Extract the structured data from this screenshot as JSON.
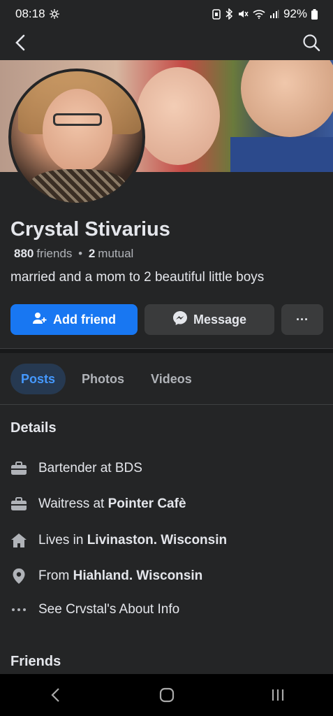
{
  "status_bar": {
    "time": "08:18",
    "battery": "92%"
  },
  "profile": {
    "name": "Crystal Stivarius",
    "friends_count": "880",
    "friends_label": "friends",
    "mutual_count": "2",
    "mutual_label": "mutual",
    "bio": "married and a mom to 2 beautiful little boys"
  },
  "actions": {
    "add_friend": "Add friend",
    "message": "Message",
    "more": "···"
  },
  "tabs": [
    {
      "label": "Posts"
    },
    {
      "label": "Photos"
    },
    {
      "label": "Videos"
    }
  ],
  "details": {
    "title": "Details",
    "items": [
      {
        "prefix": "Bartender at BDS",
        "bold": ""
      },
      {
        "prefix": "Waitress at ",
        "bold": "Pointer Cafè"
      },
      {
        "prefix": "Lives in ",
        "bold": "Livinaston. Wisconsin"
      },
      {
        "prefix": "From ",
        "bold": "Hiahland. Wisconsin"
      },
      {
        "prefix": "See Crvstal's About Info",
        "bold": ""
      }
    ]
  },
  "friends_section": {
    "title": "Friends"
  },
  "colors": {
    "accent": "#1877f2",
    "background": "#242526",
    "button_secondary": "#3a3b3c",
    "tab_active_bg": "#263951"
  }
}
